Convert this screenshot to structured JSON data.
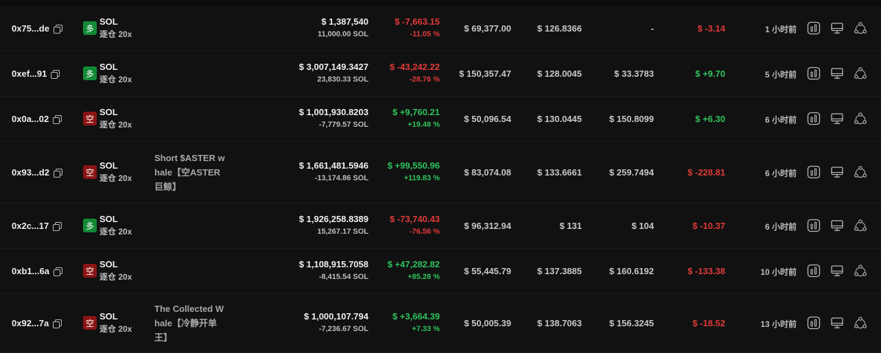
{
  "rows": [
    {
      "address": "0x75...de",
      "side": "long",
      "side_label": "多",
      "symbol": "SOL",
      "leverage": "逐仓 20x",
      "note": "",
      "position_value": "$ 1,387,540",
      "position_size": "11,000.00 SOL",
      "pnl": "$ -7,663.15",
      "pnl_pct": "-11.05 %",
      "pnl_sign": "neg",
      "margin_value": "$ 69,377.00",
      "entry_price": "$ 126.8366",
      "liq_price": "-",
      "funding": "$ -3.14",
      "funding_sign": "neg",
      "time_ago": "1 小时前"
    },
    {
      "address": "0xef...91",
      "side": "long",
      "side_label": "多",
      "symbol": "SOL",
      "leverage": "逐仓 20x",
      "note": "",
      "position_value": "$ 3,007,149.3427",
      "position_size": "23,830.33 SOL",
      "pnl": "$ -43,242.22",
      "pnl_pct": "-28.76 %",
      "pnl_sign": "neg",
      "margin_value": "$ 150,357.47",
      "entry_price": "$ 128.0045",
      "liq_price": "$ 33.3783",
      "funding": "$ +9.70",
      "funding_sign": "pos",
      "time_ago": "5 小时前"
    },
    {
      "address": "0x0a...02",
      "side": "short",
      "side_label": "空",
      "symbol": "SOL",
      "leverage": "逐仓 20x",
      "note": "",
      "position_value": "$ 1,001,930.8203",
      "position_size": "-7,779.57 SOL",
      "pnl": "$ +9,760.21",
      "pnl_pct": "+19.48 %",
      "pnl_sign": "pos",
      "margin_value": "$ 50,096.54",
      "entry_price": "$ 130.0445",
      "liq_price": "$ 150.8099",
      "funding": "$ +6.30",
      "funding_sign": "pos",
      "time_ago": "6 小时前"
    },
    {
      "address": "0x93...d2",
      "side": "short",
      "side_label": "空",
      "symbol": "SOL",
      "leverage": "逐仓 20x",
      "note": "Short $ASTER w\nhale【空ASTER\n巨鲸】",
      "position_value": "$ 1,661,481.5946",
      "position_size": "-13,174.86 SOL",
      "pnl": "$ +99,550.96",
      "pnl_pct": "+119.83 %",
      "pnl_sign": "pos",
      "margin_value": "$ 83,074.08",
      "entry_price": "$ 133.6661",
      "liq_price": "$ 259.7494",
      "funding": "$ -228.81",
      "funding_sign": "neg",
      "time_ago": "6 小时前"
    },
    {
      "address": "0x2c...17",
      "side": "long",
      "side_label": "多",
      "symbol": "SOL",
      "leverage": "逐仓 20x",
      "note": "",
      "position_value": "$ 1,926,258.8389",
      "position_size": "15,267.17 SOL",
      "pnl": "$ -73,740.43",
      "pnl_pct": "-76.56 %",
      "pnl_sign": "neg",
      "margin_value": "$ 96,312.94",
      "entry_price": "$ 131",
      "liq_price": "$ 104",
      "funding": "$ -10.37",
      "funding_sign": "neg",
      "time_ago": "6 小时前"
    },
    {
      "address": "0xb1...6a",
      "side": "short",
      "side_label": "空",
      "symbol": "SOL",
      "leverage": "逐仓 20x",
      "note": "",
      "position_value": "$ 1,108,915.7058",
      "position_size": "-8,415.54 SOL",
      "pnl": "$ +47,282.82",
      "pnl_pct": "+85.28 %",
      "pnl_sign": "pos",
      "margin_value": "$ 55,445.79",
      "entry_price": "$ 137.3885",
      "liq_price": "$ 160.6192",
      "funding": "$ -133.38",
      "funding_sign": "neg",
      "time_ago": "10 小时前"
    },
    {
      "address": "0x92...7a",
      "side": "short",
      "side_label": "空",
      "symbol": "SOL",
      "leverage": "逐仓 20x",
      "note": "The Collected W\nhale【冷静开单\n王】",
      "position_value": "$ 1,000,107.794",
      "position_size": "-7,236.67 SOL",
      "pnl": "$ +3,664.39",
      "pnl_pct": "+7.33 %",
      "pnl_sign": "pos",
      "margin_value": "$ 50,005.39",
      "entry_price": "$ 138.7063",
      "liq_price": "$ 156.3245",
      "funding": "$ -18.52",
      "funding_sign": "neg",
      "time_ago": "13 小时前"
    }
  ],
  "icons": [
    "chart-icon",
    "monitor-icon",
    "share-icon"
  ],
  "colors": {
    "background": "#111111",
    "positive": "#2ec35c",
    "negative": "#e23a3a",
    "long_badge": "#138a36",
    "short_badge": "#8b1414"
  }
}
